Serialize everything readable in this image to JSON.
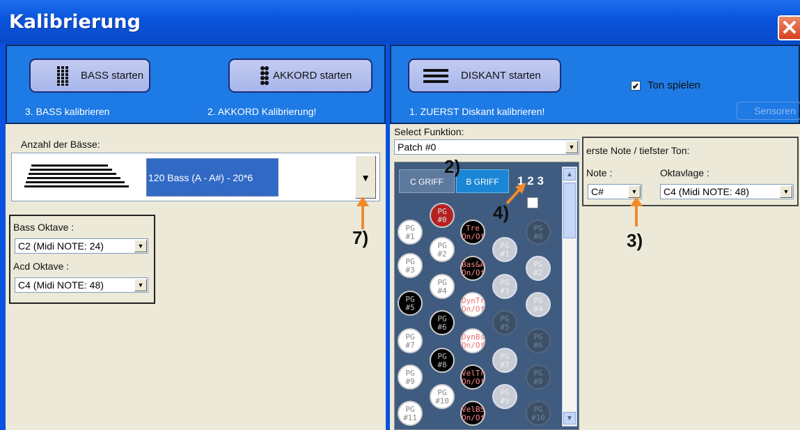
{
  "window": {
    "title": "Kalibrierung",
    "close_glyph": "✕"
  },
  "bass_panel": {
    "bass_button": "BASS starten",
    "akkord_button": "AKKORD starten",
    "bass_caption": "3. BASS kalibrieren",
    "akkord_caption": "2. AKKORD Kalibrierung!",
    "anzahl_label": "Anzahl der Bässe:",
    "anzahl_value": "120 Bass (A - A#)  - 20*6",
    "bass_oktave_label": "Bass Oktave :",
    "bass_oktave_value": "C2  (Midi NOTE: 24)",
    "acd_oktave_label": "Acd Oktave :",
    "acd_oktave_value": "C4  (Midi NOTE: 48)"
  },
  "diskant_panel": {
    "diskant_button": "DISKANT starten",
    "diskant_caption": "1. ZUERST Diskant kalibrieren!",
    "ton_spielen_label": "Ton spielen",
    "ton_spielen_checked": true,
    "sensoren_button": "Sensoren",
    "select_funktion_label": "Select Funktion:",
    "select_funktion_value": "Patch #0",
    "erste_note_label": "erste Note / tiefster Ton:",
    "note_label": "Note :",
    "note_value": "C#",
    "oktavlage_label": "Oktavlage :",
    "oktavlage_value": "C4  (Midi NOTE: 48)"
  },
  "keypad": {
    "tabs": [
      "C GRIFF",
      "B GRIFF",
      "1 2 3"
    ],
    "keys": [
      "PG #0",
      "PG #1",
      "PG #2",
      "PG #3",
      "PG #4",
      "PG #5",
      "PG #6",
      "PG #7",
      "PG #8",
      "PG #9",
      "PG #10",
      "PG #11"
    ],
    "toggles": [
      "Tre On/Of",
      "Bas&A On/Of",
      "DynTr On/Of",
      "DynBs On/Of",
      "VelTr On/Of",
      "VelBS On/Of"
    ],
    "dim_keys": [
      "PG #0",
      "PG #1",
      "PG #2",
      "PG #3",
      "PG #4",
      "PG #5",
      "PG #6",
      "PG #7",
      "PG #8",
      "PG #9",
      "PG #10"
    ]
  },
  "annotations": {
    "a2": "2)",
    "a3": "3)",
    "a4": "4)",
    "a7": "7)"
  },
  "colors": {
    "title_bar": "#0a56dc",
    "panel": "#ece9d8",
    "button_panel": "#1e7ae4",
    "arrow": "#f08a2c"
  }
}
